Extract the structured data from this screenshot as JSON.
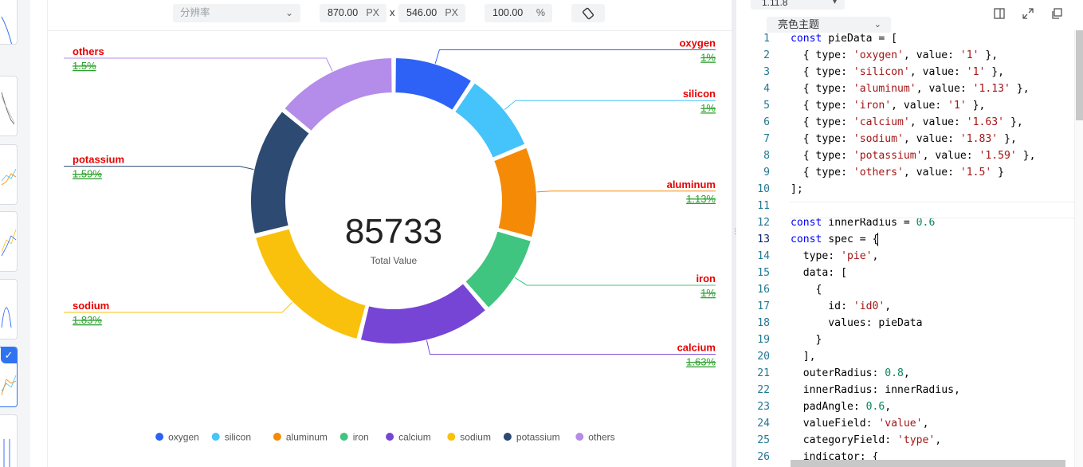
{
  "toolbar": {
    "resolution_placeholder": "分辨率",
    "width_value": "870.00",
    "height_value": "546.00",
    "unit": "PX",
    "times": "x",
    "zoom_value": "100.00",
    "zoom_unit": "%"
  },
  "editor": {
    "version": "1.11.8",
    "theme": "亮色主题",
    "current_line": 13,
    "lines": [
      {
        "n": "1",
        "t": "const pieData = ["
      },
      {
        "n": "2",
        "t": "  { type: 'oxygen', value: '1' },"
      },
      {
        "n": "3",
        "t": "  { type: 'silicon', value: '1' },"
      },
      {
        "n": "4",
        "t": "  { type: 'aluminum', value: '1.13' },"
      },
      {
        "n": "5",
        "t": "  { type: 'iron', value: '1' },"
      },
      {
        "n": "6",
        "t": "  { type: 'calcium', value: '1.63' },"
      },
      {
        "n": "7",
        "t": "  { type: 'sodium', value: '1.83' },"
      },
      {
        "n": "8",
        "t": "  { type: 'potassium', value: '1.59' },"
      },
      {
        "n": "9",
        "t": "  { type: 'others', value: '1.5' }"
      },
      {
        "n": "10",
        "t": "];"
      },
      {
        "n": "11",
        "t": ""
      },
      {
        "n": "12",
        "t": "const innerRadius = 0.6"
      },
      {
        "n": "13",
        "t": "const spec = {"
      },
      {
        "n": "14",
        "t": "  type: 'pie',"
      },
      {
        "n": "15",
        "t": "  data: ["
      },
      {
        "n": "16",
        "t": "    {"
      },
      {
        "n": "17",
        "t": "      id: 'id0',"
      },
      {
        "n": "18",
        "t": "      values: pieData"
      },
      {
        "n": "19",
        "t": "    }"
      },
      {
        "n": "20",
        "t": "  ],"
      },
      {
        "n": "21",
        "t": "  outerRadius: 0.8,"
      },
      {
        "n": "22",
        "t": "  innerRadius: innerRadius,"
      },
      {
        "n": "23",
        "t": "  padAngle: 0.6,"
      },
      {
        "n": "24",
        "t": "  valueField: 'value',"
      },
      {
        "n": "25",
        "t": "  categoryField: 'type',"
      },
      {
        "n": "26",
        "t": "  indicator: {"
      }
    ]
  },
  "chart_data": {
    "type": "pie",
    "indicator_value": "85733",
    "indicator_title": "Total Value",
    "inner_radius_ratio": 0.6,
    "slices": [
      {
        "name": "oxygen",
        "value": 1,
        "label": "1%",
        "color": "#2e62f6"
      },
      {
        "name": "silicon",
        "value": 1,
        "label": "1%",
        "color": "#45c4fb"
      },
      {
        "name": "aluminum",
        "value": 1.13,
        "label": "1.13%",
        "color": "#f58a06"
      },
      {
        "name": "iron",
        "value": 1,
        "label": "1%",
        "color": "#3fc57f"
      },
      {
        "name": "calcium",
        "value": 1.63,
        "label": "1.63%",
        "color": "#7645d6"
      },
      {
        "name": "sodium",
        "value": 1.83,
        "label": "1.83%",
        "color": "#f9c10b"
      },
      {
        "name": "potassium",
        "value": 1.59,
        "label": "1.59%",
        "color": "#2d4a72"
      },
      {
        "name": "others",
        "value": 1.5,
        "label": "1.5%",
        "color": "#b48ce9"
      }
    ],
    "label_name_color": "#e60000",
    "label_value_color": "#2ca02c",
    "legend_position": "bottom"
  }
}
